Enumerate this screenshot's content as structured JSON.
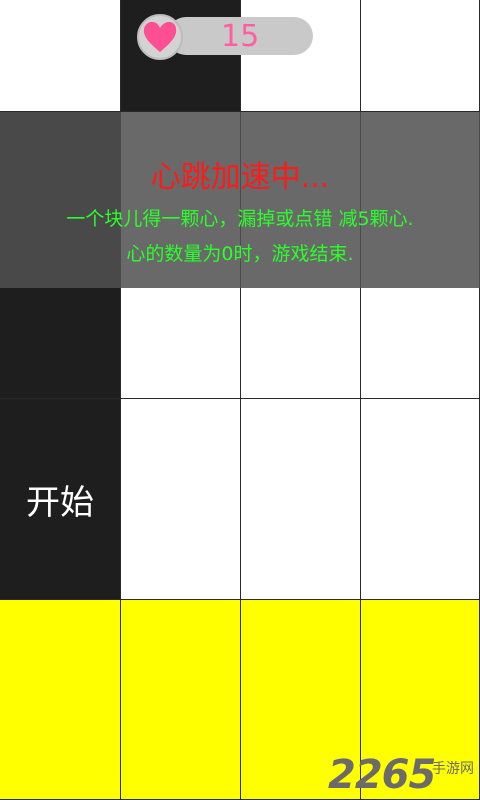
{
  "hud": {
    "heart_count": "15",
    "heart_color": "#ff4f93"
  },
  "board": {
    "columns": 4,
    "colors": {
      "white": "#ffffff",
      "black": "#1e1e1e",
      "yellow": "#ffff00"
    },
    "start_label": "开始"
  },
  "instructions": {
    "title": "心跳加速中...",
    "line1": "一个块儿得一颗心，漏掉或点错 减5颗心.",
    "line2": "心的数量为0时，游戏结束."
  },
  "watermark": {
    "number": "2265",
    "text": "手游网"
  }
}
